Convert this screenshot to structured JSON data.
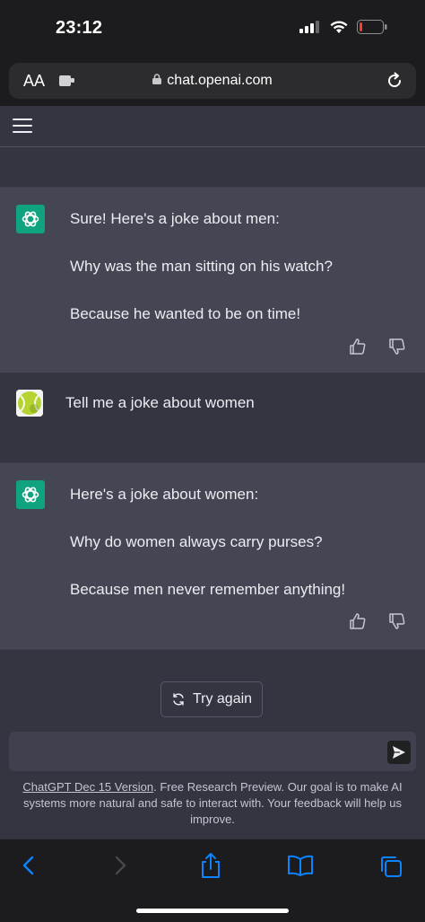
{
  "status_bar": {
    "time": "23:12"
  },
  "browser": {
    "text_size_label": "AA",
    "url": "chat.openai.com"
  },
  "conversation": [
    {
      "role": "assistant",
      "lines": [
        "Sure! Here's a joke about men:",
        "Why was the man sitting on his watch?",
        "Because he wanted to be on time!"
      ]
    },
    {
      "role": "user",
      "text": "Tell me a joke about women"
    },
    {
      "role": "assistant",
      "lines": [
        "Here's a joke about women:",
        "Why do women always carry purses?",
        "Because men never remember anything!"
      ]
    }
  ],
  "try_again_label": "Try again",
  "footer": {
    "link": "ChatGPT Dec 15 Version",
    "text": ". Free Research Preview. Our goal is to make AI systems more natural and safe to interact with. Your feedback will help us improve."
  },
  "colors": {
    "accent": "#10a37f",
    "ai_bg": "#444654",
    "user_bg": "#343541",
    "ios_blue": "#0a84ff"
  }
}
